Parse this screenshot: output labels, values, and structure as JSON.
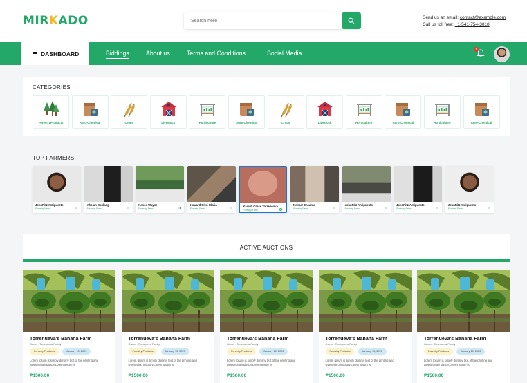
{
  "brand": {
    "part1": "MIR",
    "part2": "K",
    "part3": "ADO"
  },
  "search": {
    "placeholder": "Search here"
  },
  "contact": {
    "email_label": "Send us an email: ",
    "email": "contact@example.com",
    "phone_label": "Call us toll free: ",
    "phone": "+1-541-754-3010"
  },
  "nav": {
    "dashboard": "DASHBOARD",
    "links": [
      "Biddings",
      "About us",
      "Terms and Conditions",
      "Social Media"
    ],
    "notifications": "1"
  },
  "categories": {
    "title": "CATEGORIES",
    "items": [
      {
        "label": "ForestryProducts",
        "icon": "trees-icon"
      },
      {
        "label": "Agro-Chemical",
        "icon": "chemical-bag-icon"
      },
      {
        "label": "Crops",
        "icon": "wheat-icon"
      },
      {
        "label": "Livestock",
        "icon": "barn-icon"
      },
      {
        "label": "Horticulture",
        "icon": "greenhouse-icon"
      },
      {
        "label": "Agro-Chemical",
        "icon": "chemical-bag-icon"
      },
      {
        "label": "Crops",
        "icon": "wheat-icon"
      },
      {
        "label": "Livestock",
        "icon": "barn-icon"
      },
      {
        "label": "Horticulture",
        "icon": "greenhouse-icon"
      },
      {
        "label": "Agro-Chemical",
        "icon": "chemical-bag-icon"
      },
      {
        "label": "Horticulture",
        "icon": "greenhouse-icon"
      },
      {
        "label": "Agro-Chemical",
        "icon": "chemical-bag-icon"
      }
    ]
  },
  "farmers": {
    "title": "TOP FARMERS",
    "items": [
      {
        "name": "JohnRitz Antipuesto",
        "sub": "Forestry Farm"
      },
      {
        "name": "Aholan Conlang",
        "sub": "Forestry Farm"
      },
      {
        "name": "Kenos Wayne",
        "sub": "Forestry Farm"
      },
      {
        "name": "Howard Glen Olaria",
        "sub": "Forestry Farm"
      },
      {
        "name": "Kaiseh Grace Torreneuva",
        "sub": "Forestry Farm"
      },
      {
        "name": "Neimar Encarna",
        "sub": "Forestry Farm"
      },
      {
        "name": "JohnRitz Antipuesto",
        "sub": "Forestry Farm"
      },
      {
        "name": "JohnRitz Antipuesto",
        "sub": "Forestry Farm"
      },
      {
        "name": "JohnRitz Antipuesto",
        "sub": "Forestry Farm"
      }
    ]
  },
  "auctions": {
    "title": "ACTIVE AUCTIONS",
    "items": [
      {
        "title": "Torrenueva's Banana Farm",
        "owner": "Owner : Torrenueva Family",
        "category": "Forestry Products",
        "date": "January 10, 2023",
        "desc": "Lorem Ipsum is simply dummy text of the printing and typesetting industry.Lorem Ipsum is",
        "price": "₱1500.00"
      },
      {
        "title": "Torrenueva's Banana Farm",
        "owner": "Owner : Torrenueva Family",
        "category": "Forestry Products",
        "date": "January 10, 2023",
        "desc": "Lorem Ipsum is simply dummy text of the printing and typesetting industry.Lorem Ipsum is",
        "price": "₱1500.00"
      },
      {
        "title": "Torrenueva's Banana Farm",
        "owner": "Owner : Torrenueva Family",
        "category": "Forestry Products",
        "date": "January 10, 2023",
        "desc": "Lorem Ipsum is simply dummy text of the printing and typesetting industry.Lorem Ipsum is",
        "price": "₱1500.00"
      },
      {
        "title": "Torrenueva's Banana Farm",
        "owner": "Owner : Torrenueva Family",
        "category": "Forestry Products",
        "date": "January 10, 2023",
        "desc": "Lorem Ipsum is simply dummy text of the printing and typesetting industry.Lorem Ipsum is",
        "price": "₱1500.00"
      },
      {
        "title": "Torrenueva's Banana Farm",
        "owner": "Owner : Torrenueva Family",
        "category": "Forestry Products",
        "date": "January 10, 2023",
        "desc": "Lorem Ipsum is simply dummy text of the printing and typesetting industry.Lorem Ipsum is",
        "price": "₱1500.00"
      }
    ]
  },
  "colors": {
    "brand_green": "#23a86a",
    "brand_yellow": "#f2b824",
    "badge_red": "#e53935",
    "selected_blue": "#1976d2"
  }
}
